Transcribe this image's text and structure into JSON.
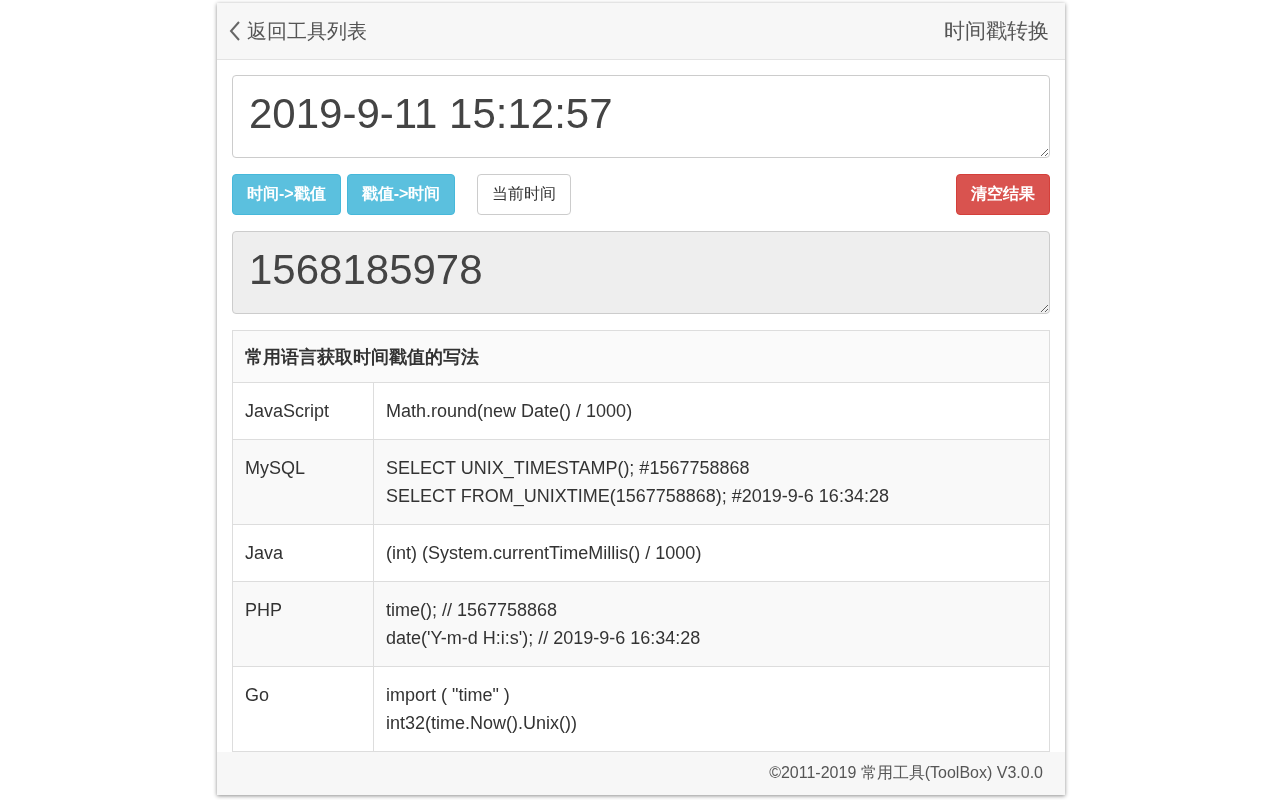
{
  "header": {
    "back_label": "返回工具列表",
    "title": "时间戳转换"
  },
  "input": {
    "value": "2019-9-11 15:12:57",
    "readonly": false
  },
  "buttons": [
    {
      "label": "时间->戳值",
      "kind": "info"
    },
    {
      "label": "戳值->时间",
      "kind": "info"
    },
    {
      "label": "当前时间",
      "kind": "default"
    },
    {
      "label": "清空结果",
      "kind": "danger"
    }
  ],
  "output": {
    "value": "1568185978",
    "readonly": true
  },
  "table": {
    "title": "常用语言获取时间戳值的写法",
    "rows": [
      {
        "language": "JavaScript",
        "code": [
          "Math.round(new Date() / 1000)"
        ]
      },
      {
        "language": "MySQL",
        "code": [
          "SELECT UNIX_TIMESTAMP(); #1567758868",
          "SELECT FROM_UNIXTIME(1567758868); #2019-9-6 16:34:28"
        ]
      },
      {
        "language": "Java",
        "code": [
          "(int) (System.currentTimeMillis() / 1000)"
        ]
      },
      {
        "language": "PHP",
        "code": [
          "time(); // 1567758868",
          "date('Y-m-d H:i:s'); // 2019-9-6 16:34:28"
        ]
      },
      {
        "language": "Go",
        "code": [
          "import ( \"time\" )",
          "int32(time.Now().Unix())"
        ]
      }
    ]
  },
  "footer": "©2011-2019 常用工具(ToolBox) V3.0.0"
}
